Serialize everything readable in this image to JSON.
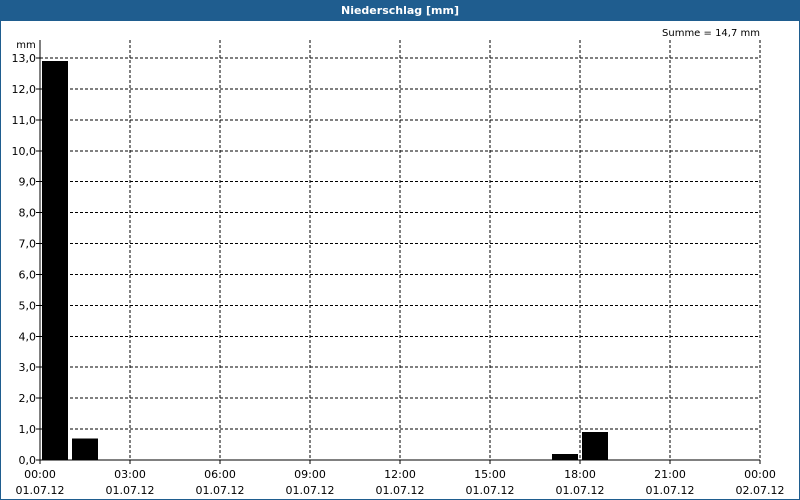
{
  "window": {
    "title": "Niederschlag [mm]"
  },
  "chart_data": {
    "type": "bar",
    "title": "Niederschlag [mm]",
    "ylabel": "mm",
    "ylim": [
      0,
      13
    ],
    "y_ticks": [
      "0,0",
      "1,0",
      "2,0",
      "3,0",
      "4,0",
      "5,0",
      "6,0",
      "7,0",
      "8,0",
      "9,0",
      "10,0",
      "11,0",
      "12,0",
      "13,0"
    ],
    "x_range_hours": [
      0,
      24
    ],
    "x_ticks": [
      {
        "time": "00:00",
        "date": "01.07.12"
      },
      {
        "time": "03:00",
        "date": "01.07.12"
      },
      {
        "time": "06:00",
        "date": "01.07.12"
      },
      {
        "time": "09:00",
        "date": "01.07.12"
      },
      {
        "time": "12:00",
        "date": "01.07.12"
      },
      {
        "time": "15:00",
        "date": "01.07.12"
      },
      {
        "time": "18:00",
        "date": "01.07.12"
      },
      {
        "time": "21:00",
        "date": "01.07.12"
      },
      {
        "time": "00:00",
        "date": "02.07.12"
      }
    ],
    "bars": [
      {
        "start_hour": 0,
        "end_hour": 1,
        "value": 12.9
      },
      {
        "start_hour": 1,
        "end_hour": 2,
        "value": 0.7
      },
      {
        "start_hour": 17,
        "end_hour": 18,
        "value": 0.2
      },
      {
        "start_hour": 18,
        "end_hour": 19,
        "value": 0.9
      }
    ],
    "annotation": "Summe = 14,7 mm",
    "grid": true,
    "bar_color": "#000000"
  }
}
